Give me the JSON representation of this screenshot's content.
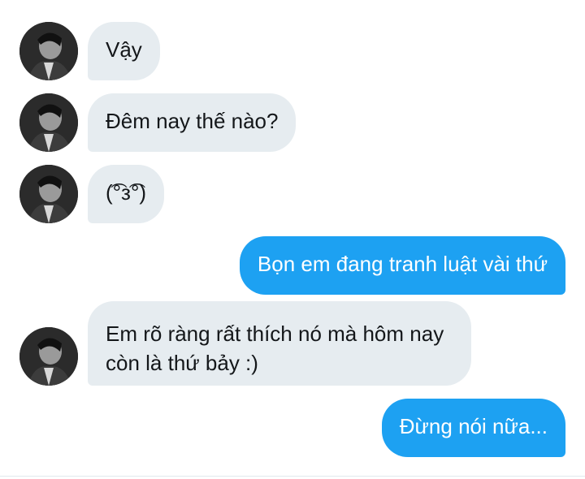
{
  "conversation": {
    "messages": [
      {
        "sender": "them",
        "text": "Vậy"
      },
      {
        "sender": "them",
        "text": "Đêm nay thế nào?"
      },
      {
        "sender": "them",
        "text": "(͡°з͡°)"
      },
      {
        "sender": "me",
        "text": "Bọn em đang tranh luật vài thứ"
      },
      {
        "sender": "them",
        "text": "Em rõ ràng rất thích nó mà hôm nay còn là thứ bảy :)"
      },
      {
        "sender": "me",
        "text": "Đừng nói nữa..."
      }
    ]
  },
  "colors": {
    "incoming_bubble": "#e6ecf0",
    "outgoing_bubble": "#1da1f2",
    "incoming_text": "#14171a",
    "outgoing_text": "#ffffff"
  }
}
